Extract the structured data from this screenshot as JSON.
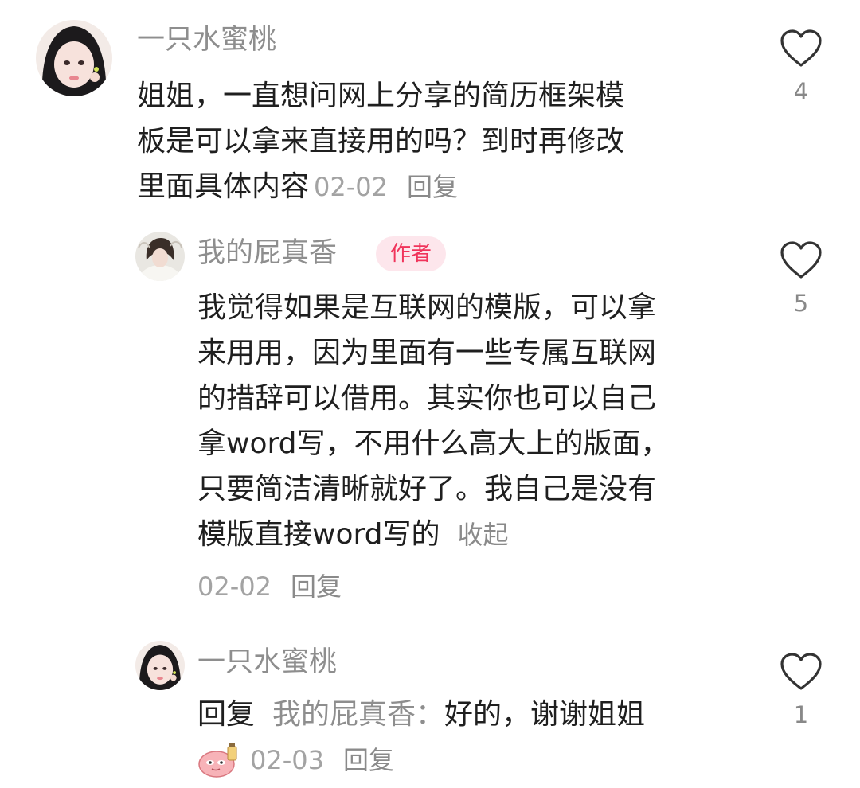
{
  "comments": [
    {
      "user": "一只水蜜桃",
      "text_lines": [
        "姐姐，一直想问网上分享的简历框架模",
        "板是可以拿来直接用的吗？到时再修改",
        "里面具体内容"
      ],
      "date": "02-02",
      "reply_label": "回复",
      "likes": "4"
    },
    {
      "user": "我的屁真香",
      "badge": "作者",
      "text_lines": [
        "我觉得如果是互联网的模版，可以拿",
        "来用用，因为里面有一些专属互联网",
        "的措辞可以借用。其实你也可以自己",
        "拿word写，不用什么高大上的版面，",
        "只要简洁清晰就好了。我自己是没有",
        "模版直接word写的"
      ],
      "collapse_label": "收起",
      "date": "02-02",
      "reply_label": "回复",
      "likes": "5"
    },
    {
      "user": "一只水蜜桃",
      "reply_prefix": "回复",
      "reply_target": "我的屁真香：",
      "text": "好的，谢谢姐姐",
      "date": "02-03",
      "reply_label": "回复",
      "likes": "1"
    }
  ],
  "icons": {
    "like": "heart-outline-icon",
    "sticker": "pink-blob-sticker"
  },
  "colors": {
    "badge_bg": "#fde6ec",
    "badge_text": "#f0345b",
    "meta": "#a3a3a3"
  }
}
